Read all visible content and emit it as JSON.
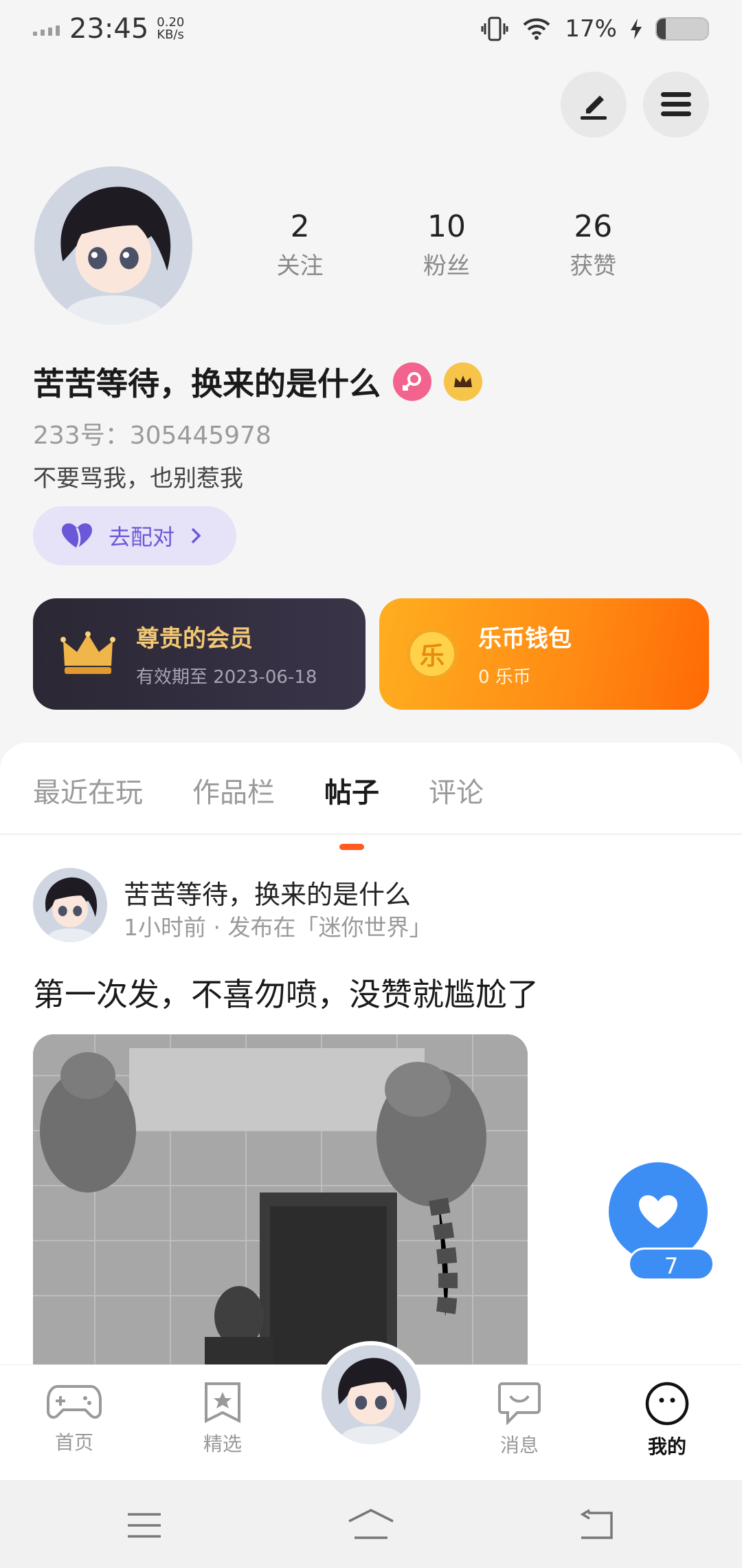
{
  "status_bar": {
    "time": "23:45",
    "speed_value": "0.20",
    "speed_unit": "KB/s",
    "battery": "17%",
    "battery_level": 0.17
  },
  "profile": {
    "stats": [
      {
        "value": "2",
        "label": "关注"
      },
      {
        "value": "10",
        "label": "粉丝"
      },
      {
        "value": "26",
        "label": "获赞"
      }
    ],
    "username": "苦苦等待，换来的是什么",
    "uid": "233号：305445978",
    "bio": "不要骂我，也别惹我",
    "pair_button": "去配对"
  },
  "cards": {
    "vip": {
      "title": "尊贵的会员",
      "subtitle": "有效期至 2023-06-18"
    },
    "wallet": {
      "icon_text": "乐",
      "title": "乐币钱包",
      "subtitle": "0 乐币"
    }
  },
  "tabs": [
    "最近在玩",
    "作品栏",
    "帖子",
    "评论"
  ],
  "active_tab": "帖子",
  "post": {
    "author": "苦苦等待，换来的是什么",
    "meta": "1小时前 · 发布在「迷你世界」",
    "text": "第一次发，不喜勿喷，没赞就尴尬了"
  },
  "like": {
    "count": "7"
  },
  "nav": {
    "home": "首页",
    "featured": "精选",
    "messages": "消息",
    "mine": "我的"
  },
  "colors": {
    "accent": "#ff5a1f",
    "like_blue": "#3c8ef5",
    "pair_purple": "#6b58d8"
  }
}
